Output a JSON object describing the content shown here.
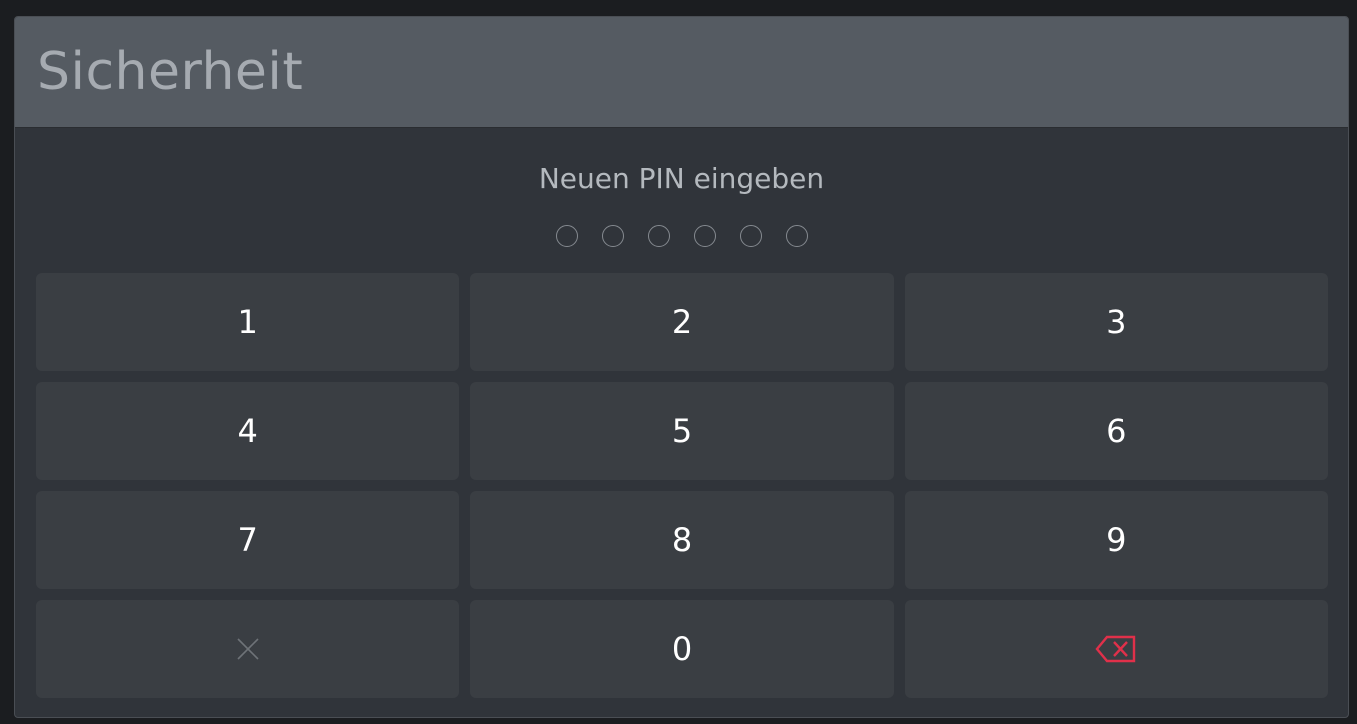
{
  "dialog": {
    "title": "Sicherheit",
    "prompt": "Neuen PIN eingeben",
    "pin_length": 6,
    "pin_entered": 0
  },
  "keypad": {
    "keys": [
      {
        "label": "1",
        "name": "key-1"
      },
      {
        "label": "2",
        "name": "key-2"
      },
      {
        "label": "3",
        "name": "key-3"
      },
      {
        "label": "4",
        "name": "key-4"
      },
      {
        "label": "5",
        "name": "key-5"
      },
      {
        "label": "6",
        "name": "key-6"
      },
      {
        "label": "7",
        "name": "key-7"
      },
      {
        "label": "8",
        "name": "key-8"
      },
      {
        "label": "9",
        "name": "key-9"
      },
      {
        "icon": "close-icon",
        "name": "clear-button"
      },
      {
        "label": "0",
        "name": "key-0"
      },
      {
        "icon": "backspace-icon",
        "name": "backspace-button"
      }
    ]
  },
  "colors": {
    "title_bar": "#555b62",
    "background": "#30343a",
    "key_background": "#3a3e43",
    "backspace_accent": "#e0304a"
  }
}
